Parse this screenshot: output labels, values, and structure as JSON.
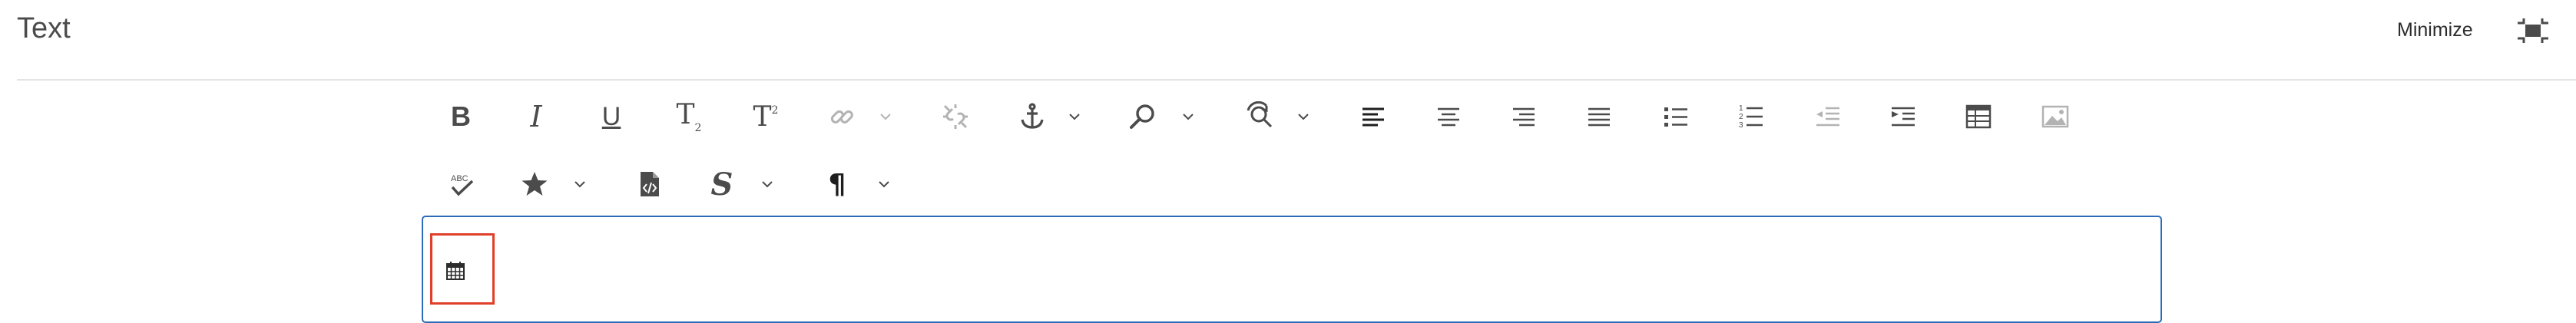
{
  "panel": {
    "title": "Text",
    "minimize_label": "Minimize"
  },
  "toolbar": {
    "row1": [
      {
        "name": "bold",
        "icon": "bold-icon",
        "label": "B"
      },
      {
        "name": "italic",
        "icon": "italic-icon",
        "label": "I"
      },
      {
        "name": "underline",
        "icon": "underline-icon",
        "label": "U"
      },
      {
        "name": "subscript",
        "icon": "subscript-icon",
        "label": "T"
      },
      {
        "name": "superscript",
        "icon": "superscript-icon",
        "label": "T"
      },
      {
        "name": "link",
        "icon": "link-icon",
        "state": "disabled",
        "has_dropdown": true
      },
      {
        "name": "unlink",
        "icon": "unlink-icon",
        "state": "disabled"
      },
      {
        "name": "anchor",
        "icon": "anchor-icon",
        "has_dropdown": true
      },
      {
        "name": "find",
        "icon": "search-icon",
        "has_dropdown": true
      },
      {
        "name": "find-replace",
        "icon": "find-replace-icon",
        "has_dropdown": true
      },
      {
        "name": "align-left",
        "icon": "align-left-icon",
        "state": "active"
      },
      {
        "name": "align-center",
        "icon": "align-center-icon"
      },
      {
        "name": "align-right",
        "icon": "align-right-icon"
      },
      {
        "name": "justify",
        "icon": "justify-icon"
      },
      {
        "name": "bullet-list",
        "icon": "bullet-list-icon"
      },
      {
        "name": "numbered-list",
        "icon": "numbered-list-icon"
      },
      {
        "name": "outdent",
        "icon": "outdent-icon",
        "state": "disabled"
      },
      {
        "name": "indent",
        "icon": "indent-icon"
      },
      {
        "name": "table",
        "icon": "table-icon"
      },
      {
        "name": "image",
        "icon": "image-icon",
        "state": "disabled"
      }
    ],
    "row2": [
      {
        "name": "spellcheck",
        "icon": "spellcheck-icon",
        "label": "ABC"
      },
      {
        "name": "special-chars",
        "icon": "star-icon",
        "has_dropdown": true
      },
      {
        "name": "source-edit",
        "icon": "source-edit-icon"
      },
      {
        "name": "styles",
        "icon": "styles-icon",
        "label": "S",
        "has_dropdown": true
      },
      {
        "name": "paragraph-format",
        "icon": "paragraph-icon",
        "label": "¶",
        "has_dropdown": true
      }
    ]
  },
  "editor": {
    "content_icon": "calendar-icon"
  },
  "colors": {
    "icon": "#4b4b4b",
    "icon_disabled": "#b3b3b3",
    "editor_border": "#2b6cb8",
    "highlight": "#e0402a"
  }
}
